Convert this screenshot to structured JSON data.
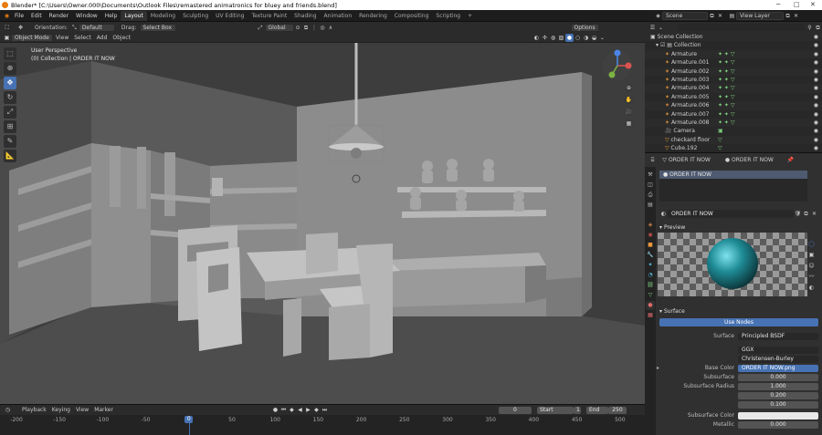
{
  "window": {
    "title": "Blender* [C:\\Users\\Owner.000\\Documents\\Outlook Files\\remastered animatronics for bluey and friends.blend]"
  },
  "menu": [
    "File",
    "Edit",
    "Render",
    "Window",
    "Help"
  ],
  "workspaces": [
    "Layout",
    "Modeling",
    "Sculpting",
    "UV Editing",
    "Texture Paint",
    "Shading",
    "Animation",
    "Rendering",
    "Compositing",
    "Scripting"
  ],
  "workspace_add": "+",
  "scene": {
    "name": "Scene",
    "view_layer": "View Layer"
  },
  "viewport_header": {
    "orientation_label": "Orientation:",
    "orientation_value": "Default",
    "drag_label": "Drag:",
    "drag_value": "Select Box",
    "transform_orientation": "Global",
    "options": "Options",
    "mode": "Object Mode",
    "menus": [
      "View",
      "Select",
      "Add",
      "Object"
    ]
  },
  "viewport_info": {
    "view": "User Perspective",
    "collection": "(0) Collection | ORDER IT NOW"
  },
  "timeline": {
    "menus": [
      "Playback",
      "Keying",
      "View",
      "Marker"
    ],
    "current_frame": "0",
    "start_label": "Start",
    "start_value": "1",
    "end_label": "End",
    "end_value": "250",
    "ruler": [
      "-200",
      "-150",
      "-100",
      "-50",
      "0",
      "50",
      "100",
      "150",
      "200",
      "250",
      "300",
      "350",
      "400",
      "450",
      "500"
    ],
    "playhead_value": "0"
  },
  "outliner": {
    "root": "Scene Collection",
    "collection": "Collection",
    "items": [
      "Armature",
      "Armature.001",
      "Armature.002",
      "Armature.003",
      "Armature.004",
      "Armature.005",
      "Armature.006",
      "Armature.007",
      "Armature.008",
      "Camera",
      "checkard floor",
      "Cube.192"
    ]
  },
  "properties": {
    "object_name": "ORDER IT NOW",
    "material_name": "ORDER IT NOW",
    "slot_item": "ORDER IT NOW",
    "material_field": "ORDER IT NOW",
    "preview_title": "Preview",
    "surface_title": "Surface",
    "use_nodes": "Use Nodes",
    "surface_label": "Surface",
    "surface_value": "Principled BSDF",
    "distribution": "GGX",
    "subsurface_method": "Christensen-Burley",
    "base_color_label": "Base Color",
    "base_color_value": "ORDER IT NOW.png",
    "subsurface_label": "Subsurface",
    "subsurface_value": "0.000",
    "subsurface_radius_label": "Subsurface Radius",
    "subsurface_radius": [
      "1.000",
      "0.200",
      "0.100"
    ],
    "subsurface_color_label": "Subsurface Color",
    "metallic_label": "Metallic",
    "metallic_value": "0.000"
  },
  "colors": {
    "accent": "#4772b3",
    "armature_icon": "#e8963b",
    "mesh_icon": "#7fcf7f",
    "viewport_bg": "#3d3d3d",
    "preview_sphere": "#1f8c96"
  }
}
